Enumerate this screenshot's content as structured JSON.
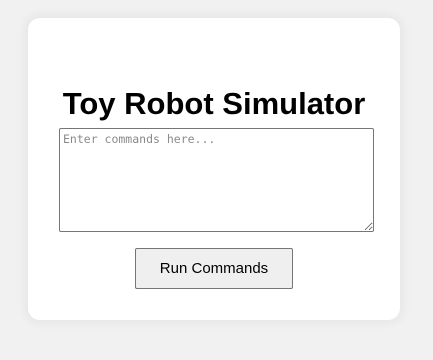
{
  "title": "Toy Robot Simulator",
  "commands_input": {
    "value": "",
    "placeholder": "Enter commands here..."
  },
  "run_button": {
    "label": "Run Commands"
  }
}
